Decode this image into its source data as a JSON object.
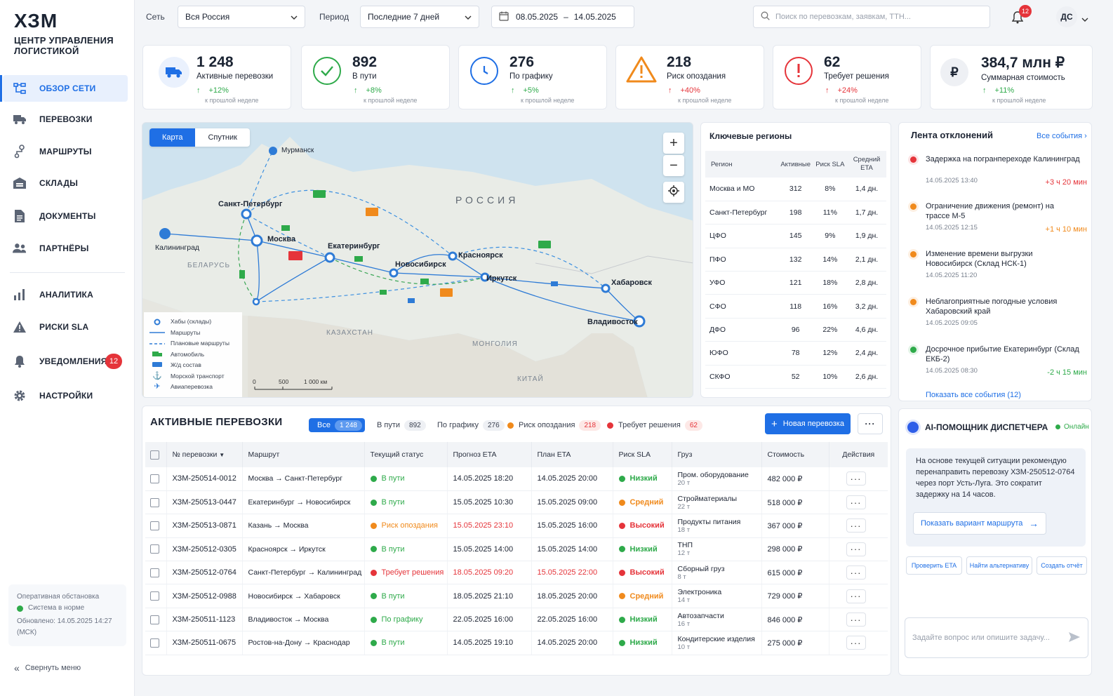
{
  "brand": {
    "logo": "ХЗМ",
    "subtitle": "ЦЕНТР УПРАВЛЕНИЯ ЛОГИСТИКОЙ"
  },
  "colors": {
    "accent": "#1f6fe5",
    "success": "#2eaa4a",
    "warning": "#f08a1c",
    "danger": "#e5343a"
  },
  "sidebar": {
    "items": [
      {
        "label": "ОБЗОР СЕТИ",
        "icon": "network-icon"
      },
      {
        "label": "ПЕРЕВОЗКИ",
        "icon": "truck-icon"
      },
      {
        "label": "МАРШРУТЫ",
        "icon": "route-icon"
      },
      {
        "label": "СКЛАДЫ",
        "icon": "warehouse-icon"
      },
      {
        "label": "ДОКУМЕНТЫ",
        "icon": "document-icon"
      },
      {
        "label": "ПАРТНЁРЫ",
        "icon": "partners-icon"
      },
      {
        "label": "АНАЛИТИКА",
        "icon": "analytics-icon"
      },
      {
        "label": "РИСКИ SLA",
        "icon": "warning-icon"
      },
      {
        "label": "УВЕДОМЛЕНИЯ",
        "icon": "bell-icon",
        "badge": "12"
      },
      {
        "label": "НАСТРОЙКИ",
        "icon": "gear-icon"
      }
    ],
    "status": {
      "title": "Оперативная обстановка",
      "ok": "Система в норме",
      "updated": "Обновлено: 14.05.2025 14:27 (МСК)"
    },
    "collapse": "Свернуть меню"
  },
  "topbar": {
    "network_label": "Сеть",
    "network_value": "Вся Россия",
    "period_label": "Период",
    "period_value": "Последние 7 дней",
    "date_from": "08.05.2025",
    "date_sep": "–",
    "date_to": "14.05.2025",
    "search_placeholder": "Поиск по перевозкам, заявкам, ТТН...",
    "notif_count": "12",
    "user_initials": "ДС"
  },
  "kpis": [
    {
      "value": "1 248",
      "label": "Активные перевозки",
      "delta": "+12%",
      "sub": "к прошлой неделе",
      "icon": "truck-icon"
    },
    {
      "value": "892",
      "label": "В пути",
      "delta": "+8%",
      "sub": "к прошлой неделе",
      "icon": "check-icon"
    },
    {
      "value": "276",
      "label": "По графику",
      "delta": "+5%",
      "sub": "к прошлой неделе",
      "icon": "clock-icon"
    },
    {
      "value": "218",
      "label": "Риск опоздания",
      "delta": "+40%",
      "sub": "к прошлой неделе",
      "icon": "warning-icon"
    },
    {
      "value": "62",
      "label": "Требует решения",
      "delta": "+24%",
      "sub": "к прошлой неделе",
      "icon": "alert-icon"
    },
    {
      "value": "384,7 млн ₽",
      "label": "Суммарная стоимость",
      "delta": "+11%",
      "sub": "к прошлой неделе",
      "icon": "ruble-icon"
    }
  ],
  "map": {
    "tab_map": "Карта",
    "tab_sat": "Спутник",
    "country_ru": "РОССИЯ",
    "country_by": "БЕЛАРУСЬ",
    "country_kz": "КАЗАХСТАН",
    "country_mn": "МОНГОЛИЯ",
    "country_cn": "КИТАЙ",
    "cities": {
      "murmansk": "Мурманск",
      "spb": "Санкт-Петербург",
      "kaliningrad": "Калининград",
      "moscow": "Москва",
      "ekb": "Екатеринбург",
      "nsk": "Новосибирск",
      "krsk": "Красноярск",
      "irk": "Иркутск",
      "khab": "Хабаровск",
      "vlad": "Владивосток"
    },
    "legend": [
      "Хабы (склады)",
      "Маршруты",
      "Плановые маршруты",
      "Автомобиль",
      "Ж/д состав",
      "Морской транспорт",
      "Авиаперевозка"
    ],
    "scale": [
      "0",
      "500",
      "1 000 км"
    ]
  },
  "regions": {
    "title": "Ключевые регионы",
    "headers": [
      "Регион",
      "Активные",
      "Риск SLA",
      "Средний ETA"
    ],
    "rows": [
      [
        "Москва и МО",
        "312",
        "8%",
        "1,4 дн."
      ],
      [
        "Санкт-Петербург",
        "198",
        "11%",
        "1,7 дн."
      ],
      [
        "ЦФО",
        "145",
        "9%",
        "1,9 дн."
      ],
      [
        "ПФО",
        "132",
        "14%",
        "2,1 дн."
      ],
      [
        "УФО",
        "121",
        "18%",
        "2,8 дн."
      ],
      [
        "СФО",
        "118",
        "16%",
        "3,2 дн."
      ],
      [
        "ДФО",
        "96",
        "22%",
        "4,6 дн."
      ],
      [
        "ЮФО",
        "78",
        "12%",
        "2,4 дн."
      ],
      [
        "СКФО",
        "52",
        "10%",
        "2,6 дн."
      ]
    ]
  },
  "feed": {
    "title": "Лента отклонений",
    "all": "Все события",
    "items": [
      {
        "title": "Задержка на погранпереходе Калининград",
        "time": "14.05.2025 13:40",
        "delta": "+3 ч 20 мин",
        "color": "#e5343a"
      },
      {
        "title": "Ограничение движения (ремонт) на трассе М-5",
        "time": "14.05.2025 12:15",
        "delta": "+1 ч 10 мин",
        "color": "#f08a1c"
      },
      {
        "title": "Изменение времени выгрузки Новосибирск (Склад НСК-1)",
        "time": "14.05.2025 11:20",
        "delta": "",
        "color": "#f08a1c"
      },
      {
        "title": "Неблагоприятные погодные условия Хабаровский край",
        "time": "14.05.2025 09:05",
        "delta": "",
        "color": "#f08a1c"
      },
      {
        "title": "Досрочное прибытие Екатеринбург (Склад ЕКБ-2)",
        "time": "14.05.2025 08:30",
        "delta": "-2 ч 15 мин",
        "color": "#2eaa4a"
      }
    ],
    "show_all": "Показать все события (12)"
  },
  "shipments": {
    "title": "АКТИВНЫЕ ПЕРЕВОЗКИ",
    "filters": [
      {
        "label": "Все",
        "count": "1 248"
      },
      {
        "label": "В пути",
        "count": "892"
      },
      {
        "label": "По графику",
        "count": "276"
      },
      {
        "label": "Риск опоздания",
        "count": "218"
      },
      {
        "label": "Требует решения",
        "count": "62"
      }
    ],
    "new_button": "Новая перевозка",
    "headers": [
      "№ перевозки",
      "Маршрут",
      "Текущий статус",
      "Прогноз ETA",
      "План ETA",
      "Риск SLA",
      "Груз",
      "Стоимость",
      "Действия"
    ],
    "rows": [
      {
        "id": "ХЗМ-250514-0012",
        "route": "Москва → Санкт-Петербург",
        "status": "В пути",
        "sc": "#2eaa4a",
        "eta": "14.05.2025 18:20",
        "etaRed": false,
        "plan": "14.05.2025 20:00",
        "planRed": false,
        "risk": "Низкий",
        "rc": "#2eaa4a",
        "cargo": "Пром. оборудование",
        "weight": "20 т",
        "cost": "482 000 ₽"
      },
      {
        "id": "ХЗМ-250513-0447",
        "route": "Екатеринбург → Новосибирск",
        "status": "В пути",
        "sc": "#2eaa4a",
        "eta": "15.05.2025 10:30",
        "etaRed": false,
        "plan": "15.05.2025 09:00",
        "planRed": false,
        "risk": "Средний",
        "rc": "#f08a1c",
        "cargo": "Стройматериалы",
        "weight": "22 т",
        "cost": "518 000 ₽"
      },
      {
        "id": "ХЗМ-250513-0871",
        "route": "Казань → Москва",
        "status": "Риск опоздания",
        "sc": "#f08a1c",
        "eta": "15.05.2025 23:10",
        "etaRed": true,
        "plan": "15.05.2025 16:00",
        "planRed": false,
        "risk": "Высокий",
        "rc": "#e5343a",
        "cargo": "Продукты питания",
        "weight": "18 т",
        "cost": "367 000 ₽"
      },
      {
        "id": "ХЗМ-250512-0305",
        "route": "Красноярск → Иркутск",
        "status": "В пути",
        "sc": "#2eaa4a",
        "eta": "15.05.2025 14:00",
        "etaRed": false,
        "plan": "15.05.2025 14:00",
        "planRed": false,
        "risk": "Низкий",
        "rc": "#2eaa4a",
        "cargo": "ТНП",
        "weight": "12 т",
        "cost": "298 000 ₽"
      },
      {
        "id": "ХЗМ-250512-0764",
        "route": "Санкт-Петербург → Калининград",
        "status": "Требует решения",
        "sc": "#e5343a",
        "eta": "18.05.2025 09:20",
        "etaRed": true,
        "plan": "15.05.2025 22:00",
        "planRed": true,
        "risk": "Высокий",
        "rc": "#e5343a",
        "cargo": "Сборный груз",
        "weight": "8 т",
        "cost": "615 000 ₽"
      },
      {
        "id": "ХЗМ-250512-0988",
        "route": "Новосибирск → Хабаровск",
        "status": "В пути",
        "sc": "#2eaa4a",
        "eta": "18.05.2025 21:10",
        "etaRed": false,
        "plan": "18.05.2025 20:00",
        "planRed": false,
        "risk": "Средний",
        "rc": "#f08a1c",
        "cargo": "Электроника",
        "weight": "14 т",
        "cost": "729 000 ₽"
      },
      {
        "id": "ХЗМ-250511-1123",
        "route": "Владивосток → Москва",
        "status": "По графику",
        "sc": "#2eaa4a",
        "eta": "22.05.2025 16:00",
        "etaRed": false,
        "plan": "22.05.2025 16:00",
        "planRed": false,
        "risk": "Низкий",
        "rc": "#2eaa4a",
        "cargo": "Автозапчасти",
        "weight": "16 т",
        "cost": "846 000 ₽"
      },
      {
        "id": "ХЗМ-250511-0675",
        "route": "Ростов-на-Дону → Краснодар",
        "status": "В пути",
        "sc": "#2eaa4a",
        "eta": "14.05.2025 19:10",
        "etaRed": false,
        "plan": "14.05.2025 20:00",
        "planRed": false,
        "risk": "Низкий",
        "rc": "#2eaa4a",
        "cargo": "Кондитерские изделия",
        "weight": "10 т",
        "cost": "275 000 ₽"
      }
    ]
  },
  "ai": {
    "title": "AI-ПОМОЩНИК ДИСПЕТЧЕРА",
    "online": "Онлайн",
    "message": "На основе текущей ситуации рекомендую перенаправить перевозку ХЗМ-250512-0764 через порт Усть-Луга. Это сократит задержку на 14 часов.",
    "show_route": "Показать вариант маршрута",
    "chips": [
      "Проверить ETA",
      "Найти альтернативу",
      "Создать отчёт"
    ],
    "input_placeholder": "Задайте вопрос или опишите задачу..."
  }
}
